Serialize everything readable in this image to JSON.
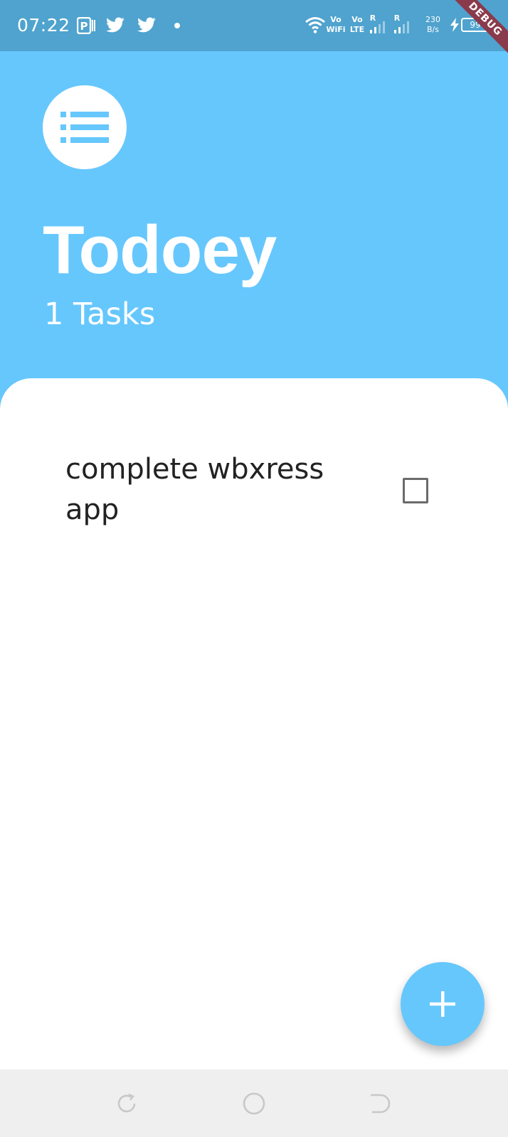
{
  "status_bar": {
    "time": "07:22",
    "wifi_label_top": "Vo",
    "wifi_label_bottom": "WiFi",
    "lte_label_top": "Vo",
    "lte_label_bottom": "LTE",
    "roaming_1": "R",
    "roaming_2": "R",
    "net_speed": "230\nB/s",
    "battery_level": "99",
    "icons": [
      "parking-icon",
      "twitter-icon",
      "twitter-icon",
      "dot-icon",
      "wifi-icon",
      "signal-icon",
      "signal-icon",
      "charging-icon",
      "battery-icon"
    ]
  },
  "debug_banner": "DEBUG",
  "header": {
    "icon": "list-icon",
    "title": "Todoey",
    "task_count": "1 Tasks"
  },
  "tasks": [
    {
      "title": "complete wbxress app",
      "done": false
    }
  ],
  "fab": {
    "icon": "plus-icon"
  },
  "nav_bar": {
    "icons": [
      "recent-apps-icon",
      "home-icon",
      "back-icon"
    ]
  },
  "colors": {
    "primary": "#66C7FD",
    "status_bar": "#4FA3CE",
    "sheet": "#FFFFFF",
    "nav_bar": "#EFEFEF",
    "task_text": "#222222"
  }
}
